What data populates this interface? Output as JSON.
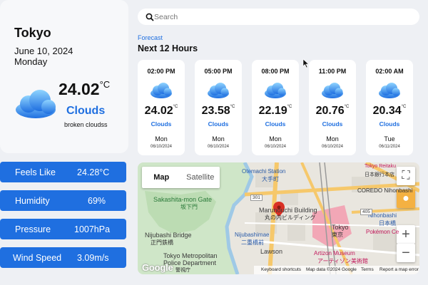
{
  "current": {
    "city": "Tokyo",
    "date": "June 10, 2024",
    "weekday": "Monday",
    "temp": "24.02",
    "unit": "°C",
    "condition": "Clouds",
    "description": "broken cloudss",
    "icon": "cloud-icon"
  },
  "stats": [
    {
      "label": "Feels Like",
      "value": "24.28°C"
    },
    {
      "label": "Humidity",
      "value": "69%"
    },
    {
      "label": "Pressure",
      "value": "1007hPa"
    },
    {
      "label": "Wind Speed",
      "value": "3.09m/s"
    }
  ],
  "search": {
    "placeholder": "Search",
    "value": ""
  },
  "forecast": {
    "label": "Forecast",
    "title": "Next 12 Hours",
    "items": [
      {
        "time": "02:00 PM",
        "temp": "24.02",
        "unit": "°C",
        "condition": "Clouds",
        "day": "Mon",
        "date": "06/10/2024"
      },
      {
        "time": "05:00 PM",
        "temp": "23.58",
        "unit": "°C",
        "condition": "Clouds",
        "day": "Mon",
        "date": "06/10/2024"
      },
      {
        "time": "08:00 PM",
        "temp": "22.19",
        "unit": "°C",
        "condition": "Clouds",
        "day": "Mon",
        "date": "06/10/2024"
      },
      {
        "time": "11:00 PM",
        "temp": "20.76",
        "unit": "°C",
        "condition": "Clouds",
        "day": "Mon",
        "date": "06/10/2024"
      },
      {
        "time": "02:00 AM",
        "temp": "20.34",
        "unit": "°C",
        "condition": "Clouds",
        "day": "Tue",
        "date": "06/11/2024"
      }
    ]
  },
  "map": {
    "type_map": "Map",
    "type_satellite": "Satellite",
    "labels": {
      "otemachi": "Otemachi Station",
      "otemachi_jp": "大手町",
      "sakashita": "Sakashita-mon Gate",
      "sakashita_jp": "坂下門",
      "marunouchi": "Marunouchi Building",
      "marunouchi_jp": "丸の内ビルディング",
      "nijubashi": "Nijubashi Bridge",
      "nijubashi_jp": "正門鉄橋",
      "nijubashimae": "Nijubashimae",
      "nijubashimae_jp": "二重橋前",
      "tokyo_station": "Tokyo",
      "tokyo_jp": "東京",
      "coredo": "COREDO Nihonbashi",
      "nihonbashi": "Nihonbashi",
      "nihonbashi_jp": "日本橋",
      "pokemon": "Pokémon Ce",
      "artizon": "Artizon Museum",
      "artizon_jp": "アーティゾン美術館",
      "lawson": "Lawson",
      "metro": "Tokyo Metropolitan",
      "police": "Police Department",
      "police_jp": "警視庁",
      "road_301": "301",
      "road_405": "405",
      "kamitsu": "Tokyo Reitaku",
      "nihonbashi_bank": "日本銀行本店"
    },
    "footer": {
      "logo": "Google",
      "keyboard": "Keyboard shortcuts",
      "mapdata": "Map data ©2024 Google",
      "terms": "Terms",
      "report": "Report a map error"
    }
  },
  "colors": {
    "accent": "#1f6fe0",
    "background": "#eef0f4",
    "card": "#ffffff"
  }
}
